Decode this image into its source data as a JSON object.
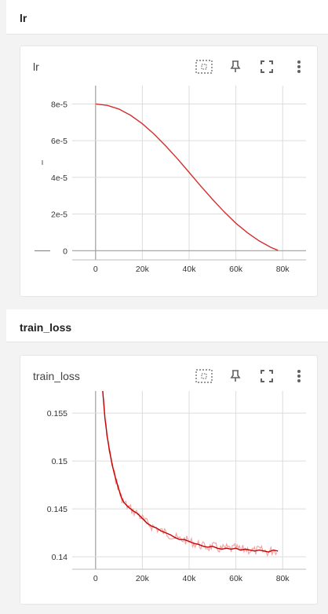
{
  "sections": [
    {
      "title": "lr",
      "card": {
        "title": "lr",
        "chart_data": {
          "type": "line",
          "title": "lr",
          "xlabel": "",
          "ylabel": "",
          "xlim": [
            -10000,
            90000
          ],
          "ylim": [
            -5e-06,
            9e-05
          ],
          "x_ticks": [
            0,
            20000,
            40000,
            60000,
            80000
          ],
          "x_tick_labels": [
            "0",
            "20k",
            "40k",
            "60k",
            "80k"
          ],
          "y_ticks": [
            0,
            2e-05,
            4e-05,
            6e-05,
            8e-05
          ],
          "y_tick_labels": [
            "0",
            "2e-5",
            "4e-5",
            "6e-5",
            "8e-5"
          ],
          "grid": true,
          "series": [
            {
              "name": "",
              "color": "#d32f2f",
              "x": [
                0,
                5000,
                10000,
                15000,
                20000,
                25000,
                30000,
                35000,
                40000,
                45000,
                50000,
                55000,
                60000,
                65000,
                70000,
                75000,
                78000
              ],
              "values": [
                8e-05,
                7.92e-05,
                7.72e-05,
                7.38e-05,
                6.92e-05,
                6.36e-05,
                5.71e-05,
                5.01e-05,
                4.27e-05,
                3.52e-05,
                2.8e-05,
                2.12e-05,
                1.5e-05,
                9.7e-06,
                5.3e-06,
                1.8e-06,
                2e-07
              ]
            }
          ]
        }
      }
    },
    {
      "title": "train_loss",
      "card": {
        "title": "train_loss",
        "chart_data": {
          "type": "line",
          "title": "train_loss",
          "xlabel": "",
          "ylabel": "",
          "xlim": [
            -10000,
            90000
          ],
          "ylim": [
            0.1387,
            0.1573
          ],
          "x_ticks": [
            0,
            20000,
            40000,
            60000,
            80000
          ],
          "x_tick_labels": [
            "0",
            "20k",
            "40k",
            "60k",
            "80k"
          ],
          "y_ticks": [
            0.14,
            0.145,
            0.15,
            0.155
          ],
          "y_tick_labels": [
            "0.14",
            "0.145",
            "0.15",
            "0.155"
          ],
          "grid": true,
          "series": [
            {
              "name": "",
              "color": "#c40000",
              "raw_color": "#f5a3a3",
              "x": [
                3000,
                4000,
                5000,
                6000,
                7000,
                8000,
                9000,
                10000,
                11000,
                12000,
                14000,
                16000,
                18000,
                20000,
                22000,
                24000,
                26000,
                28000,
                30000,
                32000,
                34000,
                36000,
                38000,
                40000,
                42000,
                44000,
                46000,
                48000,
                50000,
                52000,
                54000,
                56000,
                58000,
                60000,
                62000,
                64000,
                66000,
                68000,
                70000,
                72000,
                74000,
                76000,
                78000
              ],
              "values": [
                0.1575,
                0.1545,
                0.1525,
                0.151,
                0.1497,
                0.1487,
                0.1478,
                0.147,
                0.1462,
                0.1457,
                0.1452,
                0.1448,
                0.1445,
                0.144,
                0.1435,
                0.1432,
                0.143,
                0.1427,
                0.1425,
                0.1423,
                0.142,
                0.1418,
                0.1418,
                0.1416,
                0.1414,
                0.1413,
                0.1411,
                0.141,
                0.1411,
                0.1409,
                0.1408,
                0.1409,
                0.1408,
                0.1409,
                0.1407,
                0.1408,
                0.1407,
                0.1406,
                0.1407,
                0.1406,
                0.1405,
                0.1407,
                0.1406
              ]
            }
          ]
        }
      }
    }
  ],
  "icons": {
    "fit": "fit-domain-icon",
    "pin": "pin-icon",
    "fullscreen": "fullscreen-icon",
    "more": "more-vert-icon"
  }
}
